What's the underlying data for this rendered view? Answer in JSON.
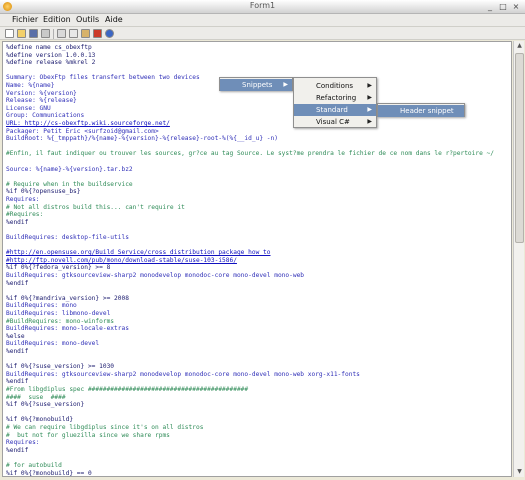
{
  "window": {
    "title": "Form1",
    "buttons": [
      "_",
      "□",
      "×"
    ]
  },
  "menu": [
    "Fichier",
    "Edition",
    "Outils",
    "Aide"
  ],
  "toolbar_icons": [
    "new-file-icon",
    "open-folder-icon",
    "save-icon",
    "print-icon",
    "cut-icon",
    "copy-icon",
    "paste-icon",
    "delete-icon",
    "help-icon"
  ],
  "editor": {
    "lines": [
      {
        "cls": "c-dir",
        "t": "%define name cs_obexftp"
      },
      {
        "cls": "c-dir",
        "t": "%define version 1.0.0.13"
      },
      {
        "cls": "c-dir",
        "t": "%define release %mkrel 2"
      },
      {
        "cls": "c-txt",
        "t": ""
      },
      {
        "cls": "c-tag",
        "t": "Summary: ObexFtp files transfert between two devices"
      },
      {
        "cls": "c-tag",
        "t": "Name: %{name}"
      },
      {
        "cls": "c-tag",
        "t": "Version: %{version}"
      },
      {
        "cls": "c-tag",
        "t": "Release: %{release}"
      },
      {
        "cls": "c-tag",
        "t": "License: GNU"
      },
      {
        "cls": "c-tag",
        "t": "Group: Communications"
      },
      {
        "cls": "c-url",
        "t": "URL: http://cs-obexftp.wiki.sourceforge.net/"
      },
      {
        "cls": "c-tag",
        "t": "Packager: Petit Eric <surfzoid@gmail.com>"
      },
      {
        "cls": "c-tag",
        "t": "BuildRoot: %{_tmppath}/%{name}-%{version}-%{release}-root-%(%{__id_u} -n)"
      },
      {
        "cls": "c-txt",
        "t": ""
      },
      {
        "cls": "c-com",
        "t": "#Enfin, il faut indiquer ou trouver les sources, gr?ce au tag Source. Le syst?me prendra le fichier de ce nom dans le r?pertoire ~/"
      },
      {
        "cls": "c-txt",
        "t": ""
      },
      {
        "cls": "c-tag",
        "t": "Source: %{name}-%{version}.tar.bz2"
      },
      {
        "cls": "c-txt",
        "t": ""
      },
      {
        "cls": "c-com",
        "t": "# Require when in the buildservice"
      },
      {
        "cls": "c-dir",
        "t": "%if 0%{?opensuse_bs}"
      },
      {
        "cls": "c-tag",
        "t": "Requires:"
      },
      {
        "cls": "c-com",
        "t": "# Not all distros build this... can't require it"
      },
      {
        "cls": "c-com",
        "t": "#Requires:"
      },
      {
        "cls": "c-dir",
        "t": "%endif"
      },
      {
        "cls": "c-txt",
        "t": ""
      },
      {
        "cls": "c-tag",
        "t": "BuildRequires: desktop-file-utils"
      },
      {
        "cls": "c-txt",
        "t": ""
      },
      {
        "cls": "c-url",
        "t": "#http://en.opensuse.org/Build_Service/cross_distribution_package_how_to"
      },
      {
        "cls": "c-url",
        "t": "#http://ftp.novell.com/pub/mono/download-stable/suse-103-i586/"
      },
      {
        "cls": "c-dir",
        "t": "%if 0%{?fedora_version} >= 8"
      },
      {
        "cls": "c-tag",
        "t": "BuildRequires: gtksourceview-sharp2 monodevelop monodoc-core mono-devel mono-web"
      },
      {
        "cls": "c-dir",
        "t": "%endif"
      },
      {
        "cls": "c-txt",
        "t": ""
      },
      {
        "cls": "c-dir",
        "t": "%if 0%{?mandriva_version} >= 2008"
      },
      {
        "cls": "c-tag",
        "t": "BuildRequires: mono"
      },
      {
        "cls": "c-tag",
        "t": "BuildRequires: libmono-devel"
      },
      {
        "cls": "c-com",
        "t": "#BuildRequires: mono-winforms"
      },
      {
        "cls": "c-tag",
        "t": "BuildRequires: mono-locale-extras"
      },
      {
        "cls": "c-dir",
        "t": "%else"
      },
      {
        "cls": "c-tag",
        "t": "BuildRequires: mono-devel"
      },
      {
        "cls": "c-dir",
        "t": "%endif"
      },
      {
        "cls": "c-txt",
        "t": ""
      },
      {
        "cls": "c-dir",
        "t": "%if 0%{?suse_version} >= 1030"
      },
      {
        "cls": "c-tag",
        "t": "BuildRequires: gtksourceview-sharp2 monodevelop monodoc-core mono-devel mono-web xorg-x11-fonts"
      },
      {
        "cls": "c-dir",
        "t": "%endif"
      },
      {
        "cls": "c-com",
        "t": "#From libgdiplus spec ###########################################"
      },
      {
        "cls": "c-com",
        "t": "####  suse  ####"
      },
      {
        "cls": "c-dir",
        "t": "%if 0%{?suse_version}"
      },
      {
        "cls": "c-txt",
        "t": ""
      },
      {
        "cls": "c-dir",
        "t": "%if 0%{?monobuild}"
      },
      {
        "cls": "c-com",
        "t": "# We can require libgdiplus since it's on all distros"
      },
      {
        "cls": "c-com",
        "t": "#  but not for gluezilla since we share rpms"
      },
      {
        "cls": "c-tag",
        "t": "Requires:"
      },
      {
        "cls": "c-dir",
        "t": "%endif"
      },
      {
        "cls": "c-txt",
        "t": ""
      },
      {
        "cls": "c-com",
        "t": "# for autobuild"
      },
      {
        "cls": "c-dir",
        "t": "%if 0%{?monobuild} == 0"
      }
    ]
  },
  "context_menu": {
    "level1": {
      "items": [
        {
          "label": "Snippets",
          "selected": true,
          "submenu": true
        }
      ]
    },
    "level2": {
      "items": [
        {
          "label": "Conditions",
          "selected": false,
          "submenu": true
        },
        {
          "label": "Refactoring",
          "selected": false,
          "submenu": true
        },
        {
          "label": "Standard",
          "selected": true,
          "submenu": true
        },
        {
          "label": "Visual C#",
          "selected": false,
          "submenu": true
        }
      ]
    },
    "level3": {
      "items": [
        {
          "label": "Header snippet",
          "selected": true,
          "submenu": false
        }
      ]
    }
  }
}
